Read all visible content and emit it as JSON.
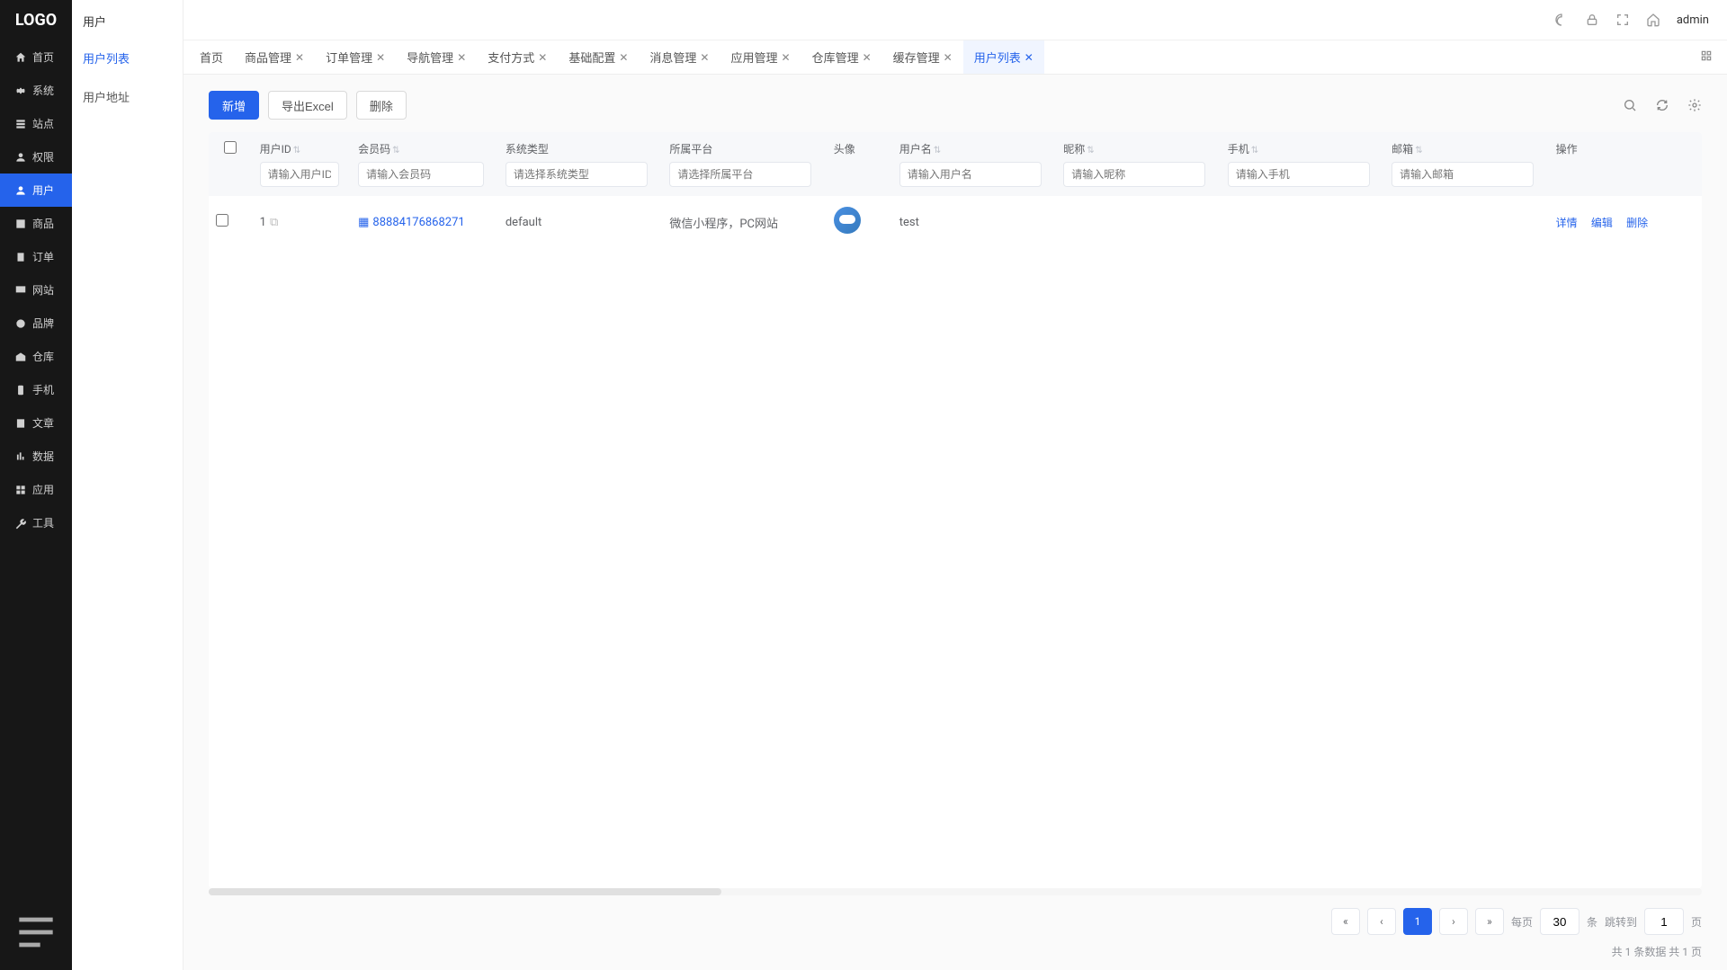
{
  "logo": "LOGO",
  "sidebar": {
    "items": [
      {
        "label": "首页"
      },
      {
        "label": "系统"
      },
      {
        "label": "站点"
      },
      {
        "label": "权限"
      },
      {
        "label": "用户"
      },
      {
        "label": "商品"
      },
      {
        "label": "订单"
      },
      {
        "label": "网站"
      },
      {
        "label": "品牌"
      },
      {
        "label": "仓库"
      },
      {
        "label": "手机"
      },
      {
        "label": "文章"
      },
      {
        "label": "数据"
      },
      {
        "label": "应用"
      },
      {
        "label": "工具"
      }
    ]
  },
  "subside": {
    "title": "用户",
    "items": [
      {
        "label": "用户列表"
      },
      {
        "label": "用户地址"
      }
    ]
  },
  "topbar": {
    "user": "admin"
  },
  "tabs": [
    {
      "label": "首页",
      "closable": false
    },
    {
      "label": "商品管理",
      "closable": true
    },
    {
      "label": "订单管理",
      "closable": true
    },
    {
      "label": "导航管理",
      "closable": true
    },
    {
      "label": "支付方式",
      "closable": true
    },
    {
      "label": "基础配置",
      "closable": true
    },
    {
      "label": "消息管理",
      "closable": true
    },
    {
      "label": "应用管理",
      "closable": true
    },
    {
      "label": "仓库管理",
      "closable": true
    },
    {
      "label": "缓存管理",
      "closable": true
    },
    {
      "label": "用户列表",
      "closable": true
    }
  ],
  "toolbar": {
    "add_label": "新增",
    "export_label": "导出Excel",
    "delete_label": "删除"
  },
  "columns": {
    "userid": {
      "label": "用户ID",
      "placeholder": "请输入用户ID"
    },
    "member": {
      "label": "会员码",
      "placeholder": "请输入会员码"
    },
    "systype": {
      "label": "系统类型",
      "placeholder": "请选择系统类型"
    },
    "platform": {
      "label": "所属平台",
      "placeholder": "请选择所属平台"
    },
    "avatar": {
      "label": "头像"
    },
    "username": {
      "label": "用户名",
      "placeholder": "请输入用户名"
    },
    "nickname": {
      "label": "昵称",
      "placeholder": "请输入昵称"
    },
    "phone": {
      "label": "手机",
      "placeholder": "请输入手机"
    },
    "email": {
      "label": "邮箱",
      "placeholder": "请输入邮箱"
    },
    "action": {
      "label": "操作"
    }
  },
  "rows": [
    {
      "userid": "1",
      "member": "88884176868271",
      "systype": "default",
      "platform": "微信小程序，PC网站",
      "username": "test",
      "nickname": "",
      "phone": "",
      "email": ""
    }
  ],
  "row_actions": {
    "detail": "详情",
    "edit": "编辑",
    "delete": "删除"
  },
  "pager": {
    "per_page_label": "每页",
    "per_page_value": "30",
    "tiao": "条",
    "jump_label": "跳转到",
    "jump_value": "1",
    "ye": "页",
    "current_page": "1",
    "summary": "共 1 条数据  共 1 页"
  }
}
